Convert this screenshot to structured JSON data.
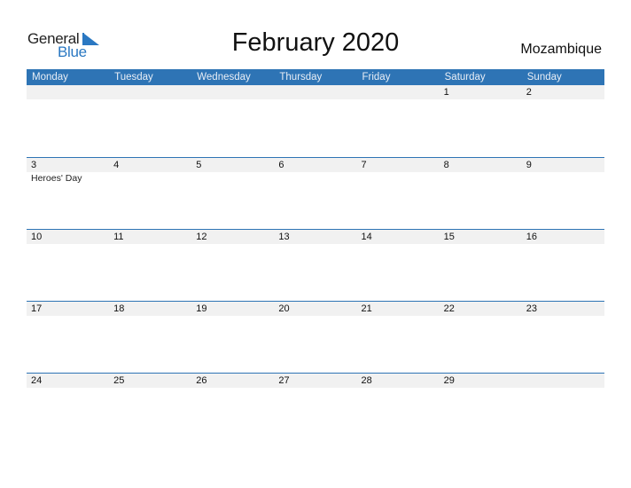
{
  "logo": {
    "general": "General",
    "blue": "Blue",
    "brand_color": "#2a78c2"
  },
  "title": "February 2020",
  "country": "Mozambique",
  "colors": {
    "header_bg": "#2e74b5",
    "strip_bg": "#f1f1f1"
  },
  "weekdays": [
    "Monday",
    "Tuesday",
    "Wednesday",
    "Thursday",
    "Friday",
    "Saturday",
    "Sunday"
  ],
  "weeks": [
    {
      "days": [
        "",
        "",
        "",
        "",
        "",
        "1",
        "2"
      ],
      "holidays": [
        "",
        "",
        "",
        "",
        "",
        "",
        ""
      ]
    },
    {
      "days": [
        "3",
        "4",
        "5",
        "6",
        "7",
        "8",
        "9"
      ],
      "holidays": [
        "Heroes' Day",
        "",
        "",
        "",
        "",
        "",
        ""
      ]
    },
    {
      "days": [
        "10",
        "11",
        "12",
        "13",
        "14",
        "15",
        "16"
      ],
      "holidays": [
        "",
        "",
        "",
        "",
        "",
        "",
        ""
      ]
    },
    {
      "days": [
        "17",
        "18",
        "19",
        "20",
        "21",
        "22",
        "23"
      ],
      "holidays": [
        "",
        "",
        "",
        "",
        "",
        "",
        ""
      ]
    },
    {
      "days": [
        "24",
        "25",
        "26",
        "27",
        "28",
        "29",
        ""
      ],
      "holidays": [
        "",
        "",
        "",
        "",
        "",
        "",
        ""
      ]
    }
  ]
}
